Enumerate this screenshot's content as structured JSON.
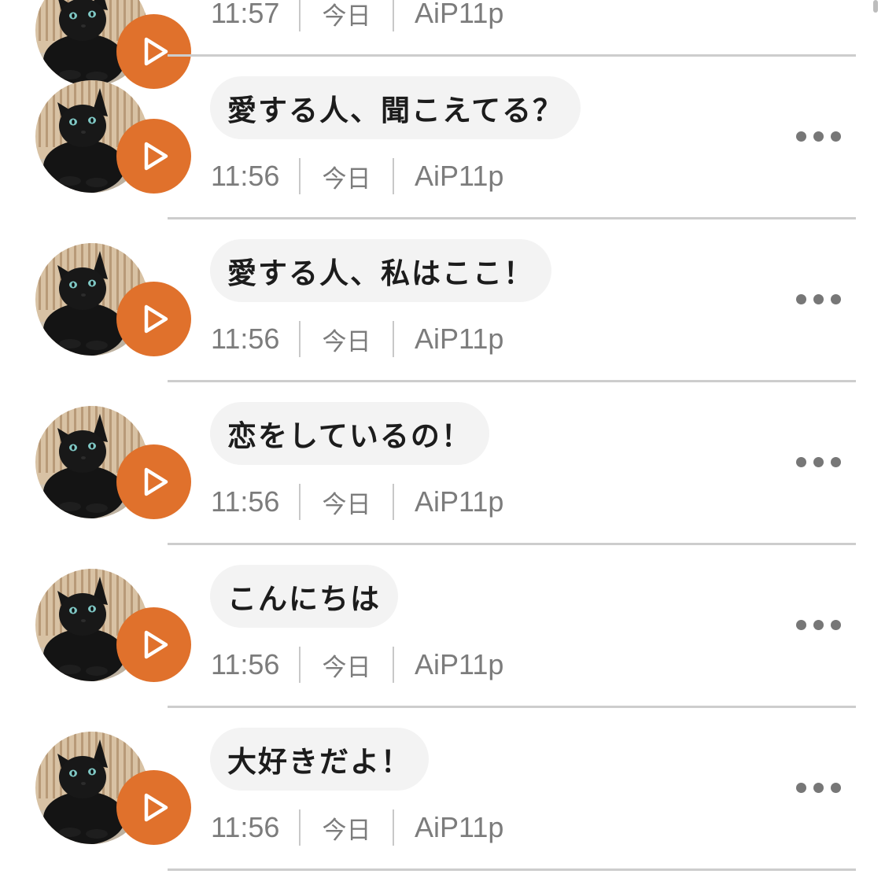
{
  "accent_color": "#e0712c",
  "avatar_icon": "black-cat-photo",
  "play_icon": "play-triangle-icon",
  "more_icon": "three-dots-icon",
  "partial_item": {
    "time": "11:57",
    "date": "今日",
    "device": "AiP11p"
  },
  "items": [
    {
      "text": "愛する人、聞こえてる？",
      "time": "11:56",
      "date": "今日",
      "device": "AiP11p"
    },
    {
      "text": "愛する人、私はここ！",
      "time": "11:56",
      "date": "今日",
      "device": "AiP11p"
    },
    {
      "text": "恋をしているの！",
      "time": "11:56",
      "date": "今日",
      "device": "AiP11p"
    },
    {
      "text": "こんにちは",
      "time": "11:56",
      "date": "今日",
      "device": "AiP11p"
    },
    {
      "text": "大好きだよ！",
      "time": "11:56",
      "date": "今日",
      "device": "AiP11p"
    }
  ]
}
